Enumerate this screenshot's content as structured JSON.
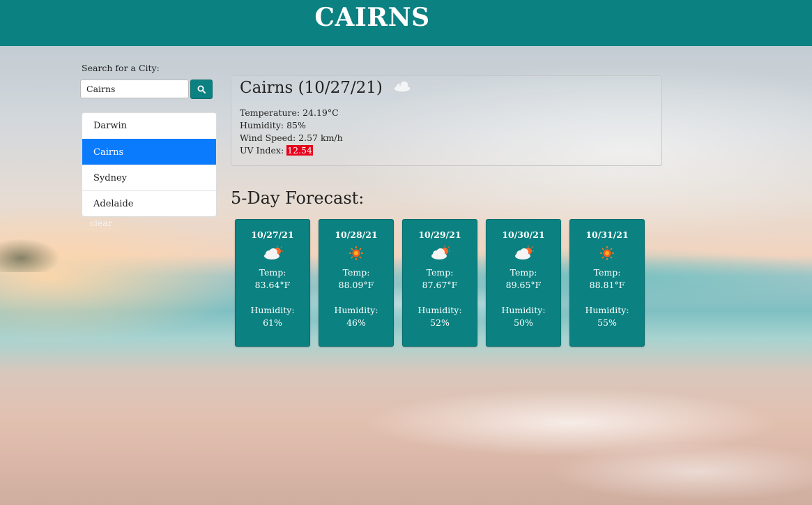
{
  "header": {
    "title": "CAIRNS"
  },
  "search": {
    "label": "Search for a City:",
    "value": "Cairns",
    "button_icon": "search-icon"
  },
  "cities": [
    {
      "name": "Darwin",
      "active": false
    },
    {
      "name": "Cairns",
      "active": true
    },
    {
      "name": "Sydney",
      "active": false
    },
    {
      "name": "Adelaide",
      "active": false
    }
  ],
  "clear_label": "clear",
  "current": {
    "title": "Cairns (10/27/21)",
    "icon": "cloud-icon",
    "temperature": "Temperature: 24.19°C",
    "humidity": "Humidity: 85%",
    "wind": "Wind Speed: 2.57 km/h",
    "uv_label": "UV Index:",
    "uv_value": "12.54"
  },
  "forecast_heading": "5-Day Forecast:",
  "forecast": [
    {
      "date": "10/27/21",
      "icon": "partly-cloudy-icon",
      "temp_label": "Temp:",
      "temp": "83.64°F",
      "humidity_label": "Humidity:",
      "humidity": "61%"
    },
    {
      "date": "10/28/21",
      "icon": "sun-icon",
      "temp_label": "Temp:",
      "temp": "88.09°F",
      "humidity_label": "Humidity:",
      "humidity": "46%"
    },
    {
      "date": "10/29/21",
      "icon": "partly-cloudy-icon",
      "temp_label": "Temp:",
      "temp": "87.67°F",
      "humidity_label": "Humidity:",
      "humidity": "52%"
    },
    {
      "date": "10/30/21",
      "icon": "partly-cloudy-icon",
      "temp_label": "Temp:",
      "temp": "89.65°F",
      "humidity_label": "Humidity:",
      "humidity": "50%"
    },
    {
      "date": "10/31/21",
      "icon": "sun-icon",
      "temp_label": "Temp:",
      "temp": "88.81°F",
      "humidity_label": "Humidity:",
      "humidity": "55%"
    }
  ],
  "colors": {
    "header": "#0b8181",
    "active_item": "#0b7bfe",
    "uv_high": "#e8001b"
  }
}
